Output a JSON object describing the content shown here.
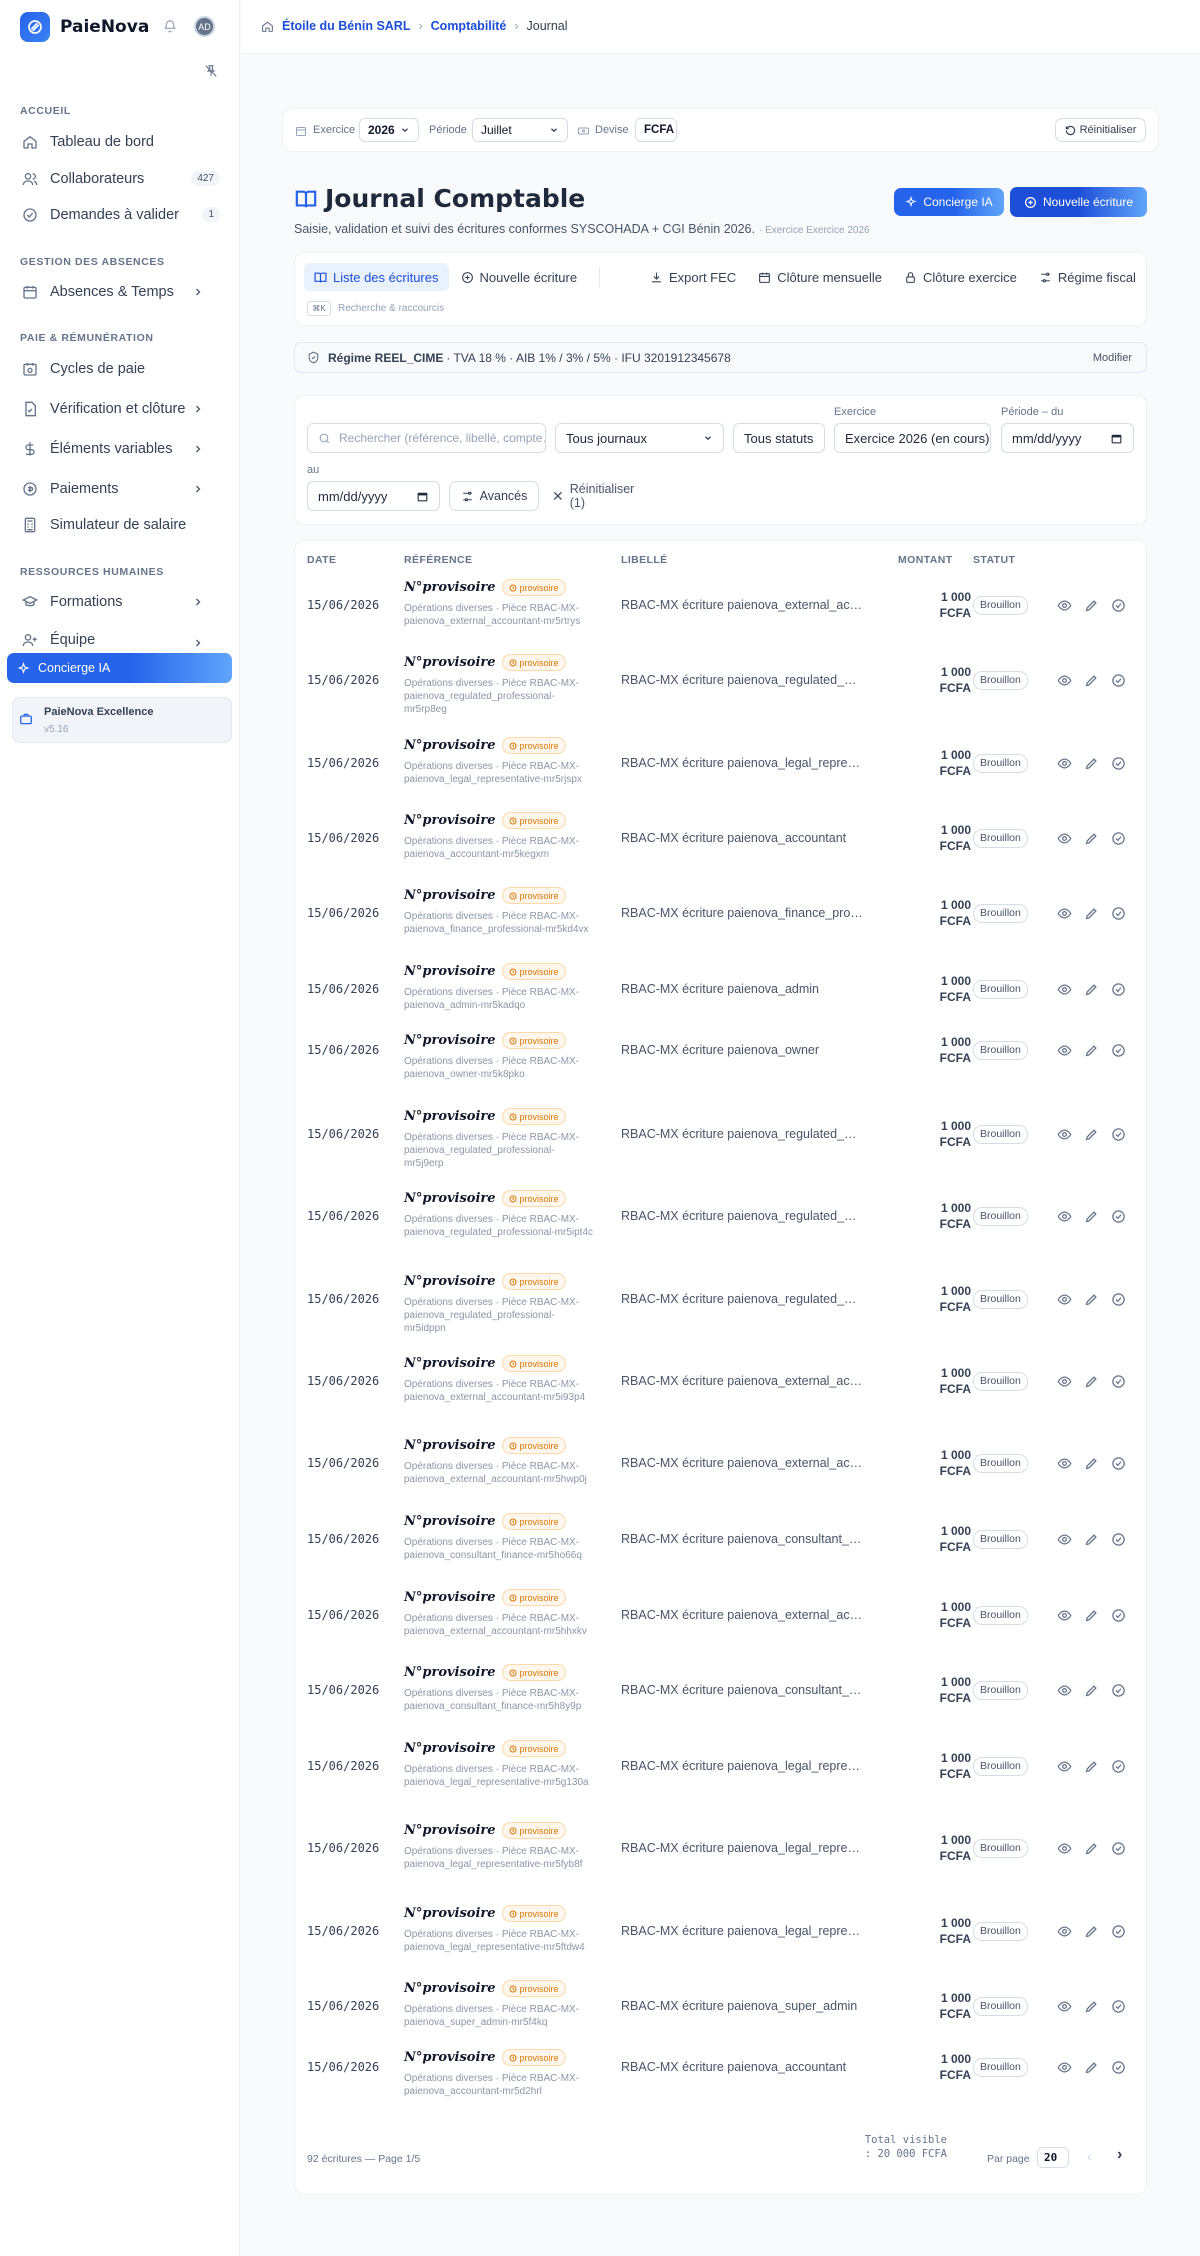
{
  "app": {
    "name": "PaieNova",
    "avatar_initials": "AD"
  },
  "sidebar": {
    "sections": [
      {
        "label": "ACCUEIL"
      },
      {
        "label": "GESTION DES ABSENCES"
      },
      {
        "label": "PAIE & RÉMUNÉRATION"
      },
      {
        "label": "RESSOURCES HUMAINES"
      }
    ],
    "items": [
      {
        "label": "Tableau de bord",
        "icon": "home-icon"
      },
      {
        "label": "Collaborateurs",
        "icon": "users-icon",
        "count": "427"
      },
      {
        "label": "Demandes à valider",
        "icon": "check-circle-icon",
        "count": "1"
      },
      {
        "label": "Absences & Temps",
        "icon": "calendar-icon"
      },
      {
        "label": "Cycles de paie",
        "icon": "cycle-icon"
      },
      {
        "label": "Vérification et clôture",
        "icon": "file-check-icon"
      },
      {
        "label": "Éléments variables",
        "icon": "dollar-icon"
      },
      {
        "label": "Paiements",
        "icon": "coin-icon"
      },
      {
        "label": "Simulateur de salaire",
        "icon": "calculator-icon"
      },
      {
        "label": "Formations",
        "icon": "graduation-icon"
      },
      {
        "label": "Équipe",
        "icon": "user-plus-icon"
      }
    ],
    "concierge": "Concierge IA",
    "excellence": {
      "name": "PaieNova Excellence",
      "version": "v5.16"
    }
  },
  "breadcrumb": {
    "items": [
      "Étoile du Bénin SARL",
      "Comptabilité",
      "Journal"
    ]
  },
  "filters_top": {
    "exercice_label": "Exercice",
    "exercice_value": "2026",
    "periode_label": "Période",
    "periode_value": "Juillet",
    "devise_label": "Devise",
    "devise_value": "FCFA",
    "reset": "Réinitialiser"
  },
  "header": {
    "title": "Journal Comptable",
    "subtitle": "Saisie, validation et suivi des écritures conformes SYSCOHADA + CGI Bénin 2026.",
    "exercise_note": "· Exercice Exercice 2026",
    "concierge_btn": "Concierge IA",
    "new_btn": "Nouvelle écriture"
  },
  "tabs": {
    "list": "Liste des écritures",
    "new": "Nouvelle écriture",
    "export": "Export FEC",
    "monthly": "Clôture mensuelle",
    "annual": "Clôture exercice",
    "regime": "Régime fiscal",
    "shortcut_key": "⌘K",
    "shortcut_label": "Recherche & raccourcis"
  },
  "regime": {
    "name": "Régime REEL_CIME",
    "details": "· TVA 18 % · AIB 1% / 3% / 5% · IFU 3201912345678",
    "edit": "Modifier"
  },
  "search": {
    "placeholder": "Rechercher (référence, libellé, compte…)",
    "journal": "Tous journaux",
    "statut": "Tous statuts",
    "exercice_label": "Exercice",
    "exercice_value": "Exercice 2026 (en cours)",
    "period_from_label": "Période – du",
    "date_placeholder": "mm/dd/yyyy",
    "period_to_label": "au",
    "advanced": "Avancés",
    "reset": "Réinitialiser (1)"
  },
  "table": {
    "headers": [
      "DATE",
      "RÉFÉRENCE",
      "LIBELLÉ",
      "MONTANT",
      "STATUT"
    ],
    "rows": [
      {
        "date": "15/06/2026",
        "ref": "N°provisoire",
        "tag": "provisoire",
        "piece": "Opérations diverses · Pièce RBAC-MX-paienova_external_accountant-mr5rtrys",
        "libelle": "RBAC-MX écriture paienova_external_accountant",
        "amount": "1 000",
        "currency": "FCFA",
        "status": "Brouillon"
      },
      {
        "date": "15/06/2026",
        "ref": "N°provisoire",
        "tag": "provisoire",
        "piece": "Opérations diverses · Pièce RBAC-MX-paienova_regulated_professional-mr5rp8eg",
        "libelle": "RBAC-MX écriture paienova_regulated_professional",
        "amount": "1 000",
        "currency": "FCFA",
        "status": "Brouillon"
      },
      {
        "date": "15/06/2026",
        "ref": "N°provisoire",
        "tag": "provisoire",
        "piece": "Opérations diverses · Pièce RBAC-MX-paienova_legal_representative-mr5rjspx",
        "libelle": "RBAC-MX écriture paienova_legal_representative",
        "amount": "1 000",
        "currency": "FCFA",
        "status": "Brouillon"
      },
      {
        "date": "15/06/2026",
        "ref": "N°provisoire",
        "tag": "provisoire",
        "piece": "Opérations diverses · Pièce RBAC-MX-paienova_accountant-mr5kegxm",
        "libelle": "RBAC-MX écriture paienova_accountant",
        "amount": "1 000",
        "currency": "FCFA",
        "status": "Brouillon"
      },
      {
        "date": "15/06/2026",
        "ref": "N°provisoire",
        "tag": "provisoire",
        "piece": "Opérations diverses · Pièce RBAC-MX-paienova_finance_professional-mr5kd4vx",
        "libelle": "RBAC-MX écriture paienova_finance_professional",
        "amount": "1 000",
        "currency": "FCFA",
        "status": "Brouillon"
      },
      {
        "date": "15/06/2026",
        "ref": "N°provisoire",
        "tag": "provisoire",
        "piece": "Opérations diverses · Pièce RBAC-MX-paienova_admin-mr5kadqo",
        "libelle": "RBAC-MX écriture paienova_admin",
        "amount": "1 000",
        "currency": "FCFA",
        "status": "Brouillon"
      },
      {
        "date": "15/06/2026",
        "ref": "N°provisoire",
        "tag": "provisoire",
        "piece": "Opérations diverses · Pièce RBAC-MX-paienova_owner-mr5k8pko",
        "libelle": "RBAC-MX écriture paienova_owner",
        "amount": "1 000",
        "currency": "FCFA",
        "status": "Brouillon"
      },
      {
        "date": "15/06/2026",
        "ref": "N°provisoire",
        "tag": "provisoire",
        "piece": "Opérations diverses · Pièce RBAC-MX-paienova_regulated_professional-mr5j9erp",
        "libelle": "RBAC-MX écriture paienova_regulated_professional",
        "amount": "1 000",
        "currency": "FCFA",
        "status": "Brouillon"
      },
      {
        "date": "15/06/2026",
        "ref": "N°provisoire",
        "tag": "provisoire",
        "piece": "Opérations diverses · Pièce RBAC-MX-paienova_regulated_professional-mr5ipt4c",
        "libelle": "RBAC-MX écriture paienova_regulated_professional",
        "amount": "1 000",
        "currency": "FCFA",
        "status": "Brouillon"
      },
      {
        "date": "15/06/2026",
        "ref": "N°provisoire",
        "tag": "provisoire",
        "piece": "Opérations diverses · Pièce RBAC-MX-paienova_regulated_professional-mr5idppn",
        "libelle": "RBAC-MX écriture paienova_regulated_professional",
        "amount": "1 000",
        "currency": "FCFA",
        "status": "Brouillon"
      },
      {
        "date": "15/06/2026",
        "ref": "N°provisoire",
        "tag": "provisoire",
        "piece": "Opérations diverses · Pièce RBAC-MX-paienova_external_accountant-mr5i93p4",
        "libelle": "RBAC-MX écriture paienova_external_accountant",
        "amount": "1 000",
        "currency": "FCFA",
        "status": "Brouillon"
      },
      {
        "date": "15/06/2026",
        "ref": "N°provisoire",
        "tag": "provisoire",
        "piece": "Opérations diverses · Pièce RBAC-MX-paienova_external_accountant-mr5hwp0j",
        "libelle": "RBAC-MX écriture paienova_external_accountant",
        "amount": "1 000",
        "currency": "FCFA",
        "status": "Brouillon"
      },
      {
        "date": "15/06/2026",
        "ref": "N°provisoire",
        "tag": "provisoire",
        "piece": "Opérations diverses · Pièce RBAC-MX-paienova_consultant_finance-mr5ho66q",
        "libelle": "RBAC-MX écriture paienova_consultant_finance",
        "amount": "1 000",
        "currency": "FCFA",
        "status": "Brouillon"
      },
      {
        "date": "15/06/2026",
        "ref": "N°provisoire",
        "tag": "provisoire",
        "piece": "Opérations diverses · Pièce RBAC-MX-paienova_external_accountant-mr5hhxkv",
        "libelle": "RBAC-MX écriture paienova_external_accountant",
        "amount": "1 000",
        "currency": "FCFA",
        "status": "Brouillon"
      },
      {
        "date": "15/06/2026",
        "ref": "N°provisoire",
        "tag": "provisoire",
        "piece": "Opérations diverses · Pièce RBAC-MX-paienova_consultant_finance-mr5h8y9p",
        "libelle": "RBAC-MX écriture paienova_consultant_finance",
        "amount": "1 000",
        "currency": "FCFA",
        "status": "Brouillon"
      },
      {
        "date": "15/06/2026",
        "ref": "N°provisoire",
        "tag": "provisoire",
        "piece": "Opérations diverses · Pièce RBAC-MX-paienova_legal_representative-mr5g130a",
        "libelle": "RBAC-MX écriture paienova_legal_representative",
        "amount": "1 000",
        "currency": "FCFA",
        "status": "Brouillon"
      },
      {
        "date": "15/06/2026",
        "ref": "N°provisoire",
        "tag": "provisoire",
        "piece": "Opérations diverses · Pièce RBAC-MX-paienova_legal_representative-mr5fyb8f",
        "libelle": "RBAC-MX écriture paienova_legal_representative",
        "amount": "1 000",
        "currency": "FCFA",
        "status": "Brouillon"
      },
      {
        "date": "15/06/2026",
        "ref": "N°provisoire",
        "tag": "provisoire",
        "piece": "Opérations diverses · Pièce RBAC-MX-paienova_legal_representative-mr5ftdw4",
        "libelle": "RBAC-MX écriture paienova_legal_representative",
        "amount": "1 000",
        "currency": "FCFA",
        "status": "Brouillon"
      },
      {
        "date": "15/06/2026",
        "ref": "N°provisoire",
        "tag": "provisoire",
        "piece": "Opérations diverses · Pièce RBAC-MX-paienova_super_admin-mr5f4kq",
        "libelle": "RBAC-MX écriture paienova_super_admin",
        "amount": "1 000",
        "currency": "FCFA",
        "status": "Brouillon"
      },
      {
        "date": "15/06/2026",
        "ref": "N°provisoire",
        "tag": "provisoire",
        "piece": "Opérations diverses · Pièce RBAC-MX-paienova_accountant-mr5d2hrl",
        "libelle": "RBAC-MX écriture paienova_accountant",
        "amount": "1 000",
        "currency": "FCFA",
        "status": "Brouillon"
      }
    ]
  },
  "footer": {
    "summary": "92 écritures — Page 1/5",
    "total": "Total visible : 20 000 FCFA",
    "per_page_label": "Par page",
    "per_page_value": "20"
  }
}
